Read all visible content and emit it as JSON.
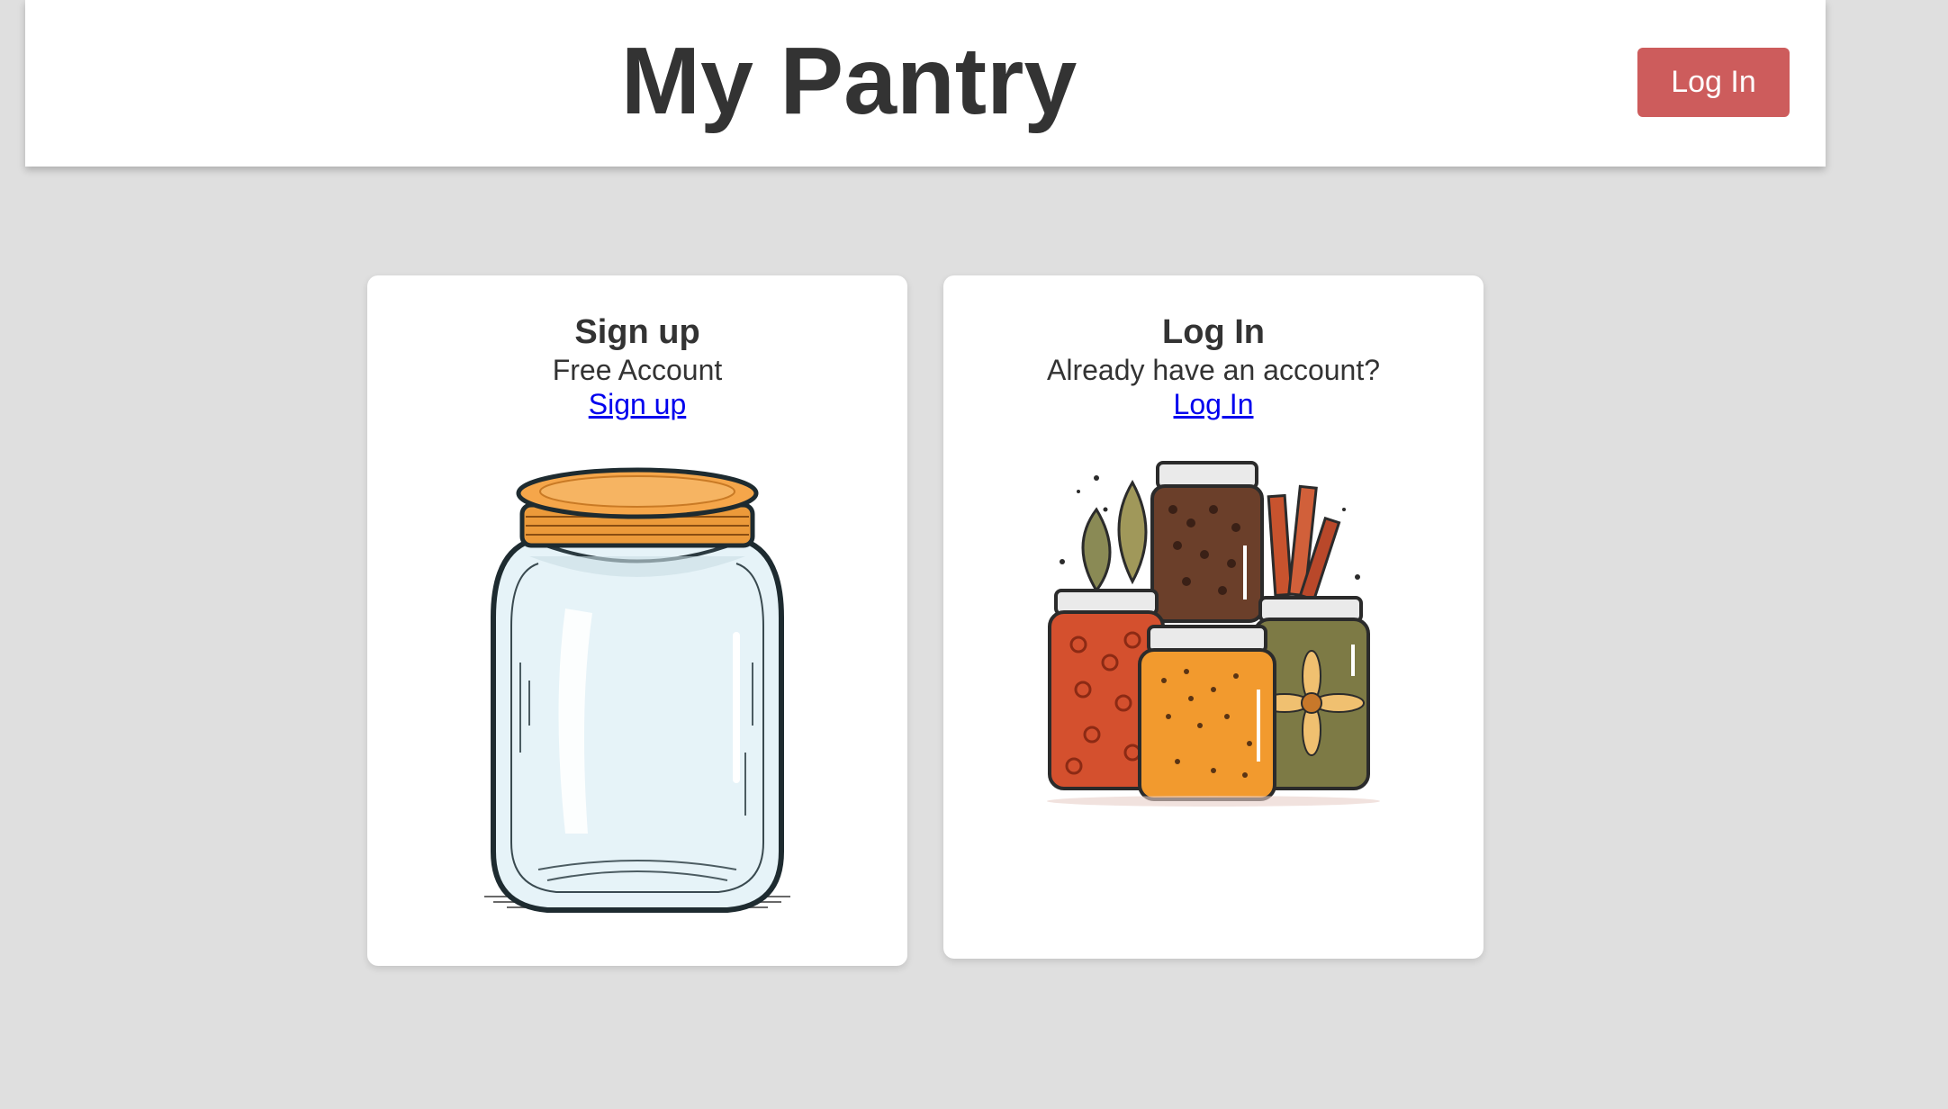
{
  "header": {
    "title": "My Pantry",
    "login_label": "Log In"
  },
  "cards": [
    {
      "title": "Sign up",
      "subtitle": "Free Account",
      "link_label": "Sign up",
      "image_icon": "empty-mason-jar-icon"
    },
    {
      "title": "Log In",
      "subtitle": "Already have an account?",
      "link_label": "Log In",
      "image_icon": "spice-jars-icon"
    }
  ],
  "colors": {
    "background": "#dfdfdf",
    "header_bg": "#ffffff",
    "login_button": "#cd5c5c",
    "link": "#0000ee",
    "text": "#333333"
  }
}
